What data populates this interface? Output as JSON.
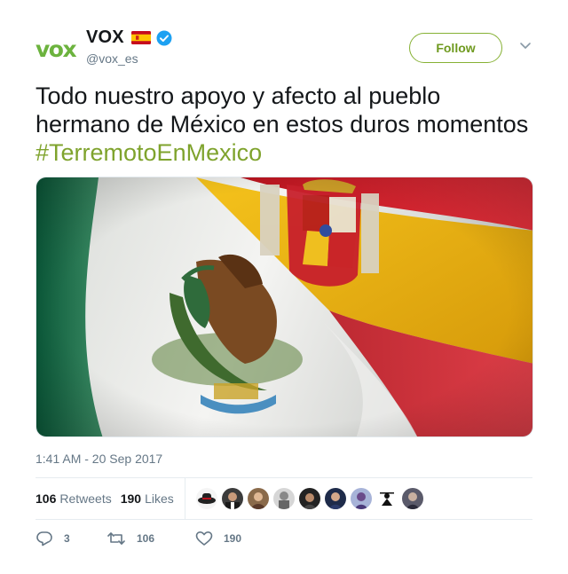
{
  "user": {
    "display_name": "VOX",
    "handle": "@vox_es",
    "avatar_text": "vox",
    "flag_icon": "spain-flag-icon",
    "verified_icon": "verified-badge-icon"
  },
  "follow_button": {
    "label": "Follow"
  },
  "tweet": {
    "text": "Todo nuestro apoyo y afecto al pueblo hermano de México en estos duros momentos ",
    "hashtag": "#TerremotoEnMexico",
    "timestamp": "1:41 AM - 20 Sep 2017"
  },
  "stats": {
    "retweets_count": "106",
    "retweets_label": "Retweets",
    "likes_count": "190",
    "likes_label": "Likes"
  },
  "actions": {
    "reply_count": "3",
    "retweet_count": "106",
    "like_count": "190"
  },
  "colors": {
    "accent": "#7fa32d",
    "follow_border": "#86b134",
    "muted": "#657786"
  }
}
